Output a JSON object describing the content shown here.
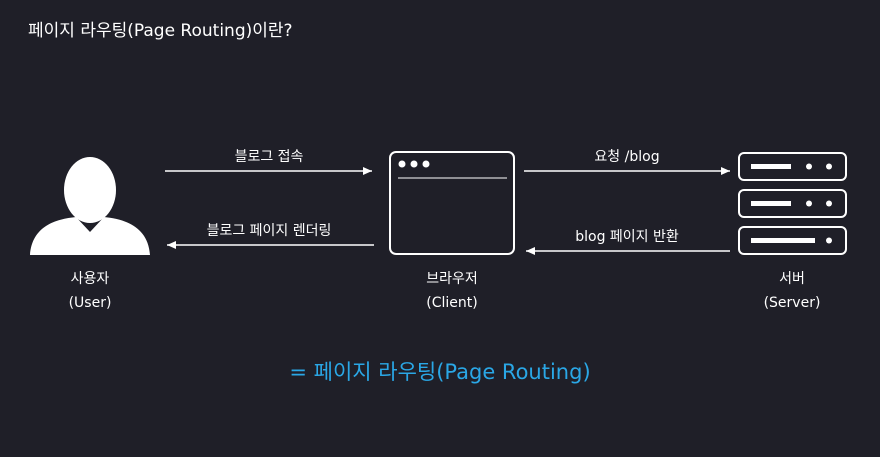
{
  "title": "페이지 라우팅(Page Routing)이란?",
  "nodes": {
    "user": {
      "name": "사용자",
      "sub": "(User)",
      "icon": "user-silhouette-icon"
    },
    "client": {
      "name": "브라우저",
      "sub": "(Client)",
      "icon": "browser-window-icon"
    },
    "server": {
      "name": "서버",
      "sub": "(Server)",
      "icon": "server-rack-icon"
    }
  },
  "edges": {
    "user_to_client": "블로그 접속",
    "client_to_user": "블로그 페이지 렌더링",
    "client_to_server": "요청 /blog",
    "server_to_client": "blog 페이지 반환"
  },
  "summary": "= 페이지 라우팅(Page Routing)",
  "colors": {
    "background": "#1f1f28",
    "foreground": "#ffffff",
    "accent": "#2aa7e6"
  }
}
